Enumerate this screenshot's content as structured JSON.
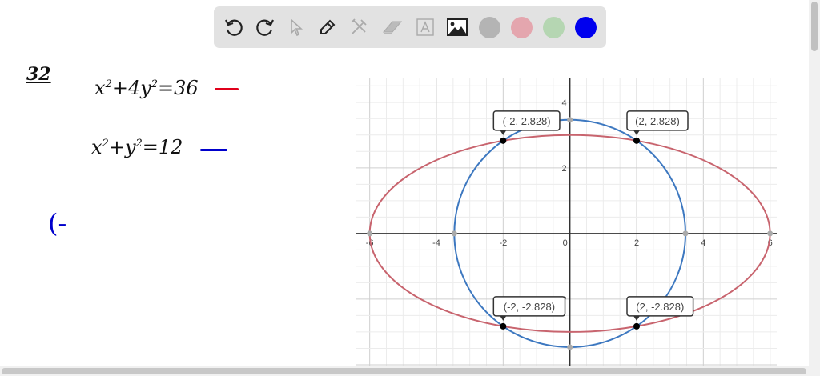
{
  "toolbar": {
    "tools": [
      {
        "name": "undo-icon",
        "enabled": true
      },
      {
        "name": "redo-icon",
        "enabled": true
      },
      {
        "name": "select-pointer-icon",
        "enabled": false
      },
      {
        "name": "pen-icon",
        "enabled": true
      },
      {
        "name": "tools-icon",
        "enabled": false
      },
      {
        "name": "eraser-icon",
        "enabled": false
      },
      {
        "name": "text-box-icon",
        "enabled": false
      },
      {
        "name": "image-icon",
        "enabled": true
      }
    ],
    "colors": [
      "#b4b4b4",
      "#e4a6ae",
      "#b5d6b2",
      "#0000ee"
    ],
    "selected_color": "#0000ee"
  },
  "notes": {
    "problem_number": "32",
    "eq1": {
      "a": "x",
      "b": "+4y",
      "c": "=36",
      "color": "#e0001b"
    },
    "eq2": {
      "a": "x",
      "b": "+y",
      "c": "=12",
      "color": "#0000cc"
    },
    "partial": "(-",
    "sup": "2"
  },
  "chart_data": {
    "type": "line",
    "xlim": [
      -6.4,
      6.2
    ],
    "ylim": [
      -4.05,
      4.75
    ],
    "grid": true,
    "x_ticks": [
      -6,
      -4,
      -2,
      0,
      2,
      4,
      6
    ],
    "y_ticks": [
      -2,
      2,
      4
    ],
    "series": [
      {
        "equation": "x^2+4y^2=36",
        "kind": "ellipse",
        "a": 6,
        "b": 3,
        "color": "#c8646e"
      },
      {
        "equation": "x^2+y^2=12",
        "kind": "circle",
        "a": 3.464,
        "b": 3.464,
        "color": "#3d78c0"
      }
    ],
    "intercepts": [
      [
        -6,
        0
      ],
      [
        6,
        0
      ],
      [
        -3.464,
        0
      ],
      [
        3.464,
        0
      ],
      [
        0,
        3.464
      ],
      [
        0,
        -3.464
      ],
      [
        0,
        3
      ],
      [
        0,
        -3
      ]
    ],
    "points": [
      {
        "x": -2,
        "y": 2.828,
        "label": "(-2, 2.828)"
      },
      {
        "x": 2,
        "y": 2.828,
        "label": "(2, 2.828)"
      },
      {
        "x": -2,
        "y": -2.828,
        "label": "(-2, -2.828)"
      },
      {
        "x": 2,
        "y": -2.828,
        "label": "(2, -2.828)"
      }
    ]
  }
}
